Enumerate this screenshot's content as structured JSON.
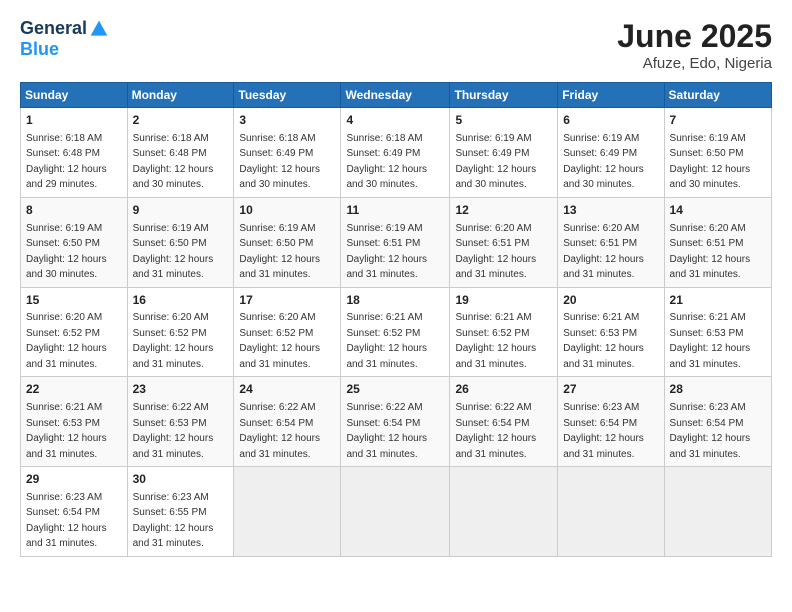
{
  "header": {
    "logo_general": "General",
    "logo_blue": "Blue",
    "month_title": "June 2025",
    "location": "Afuze, Edo, Nigeria"
  },
  "days_of_week": [
    "Sunday",
    "Monday",
    "Tuesday",
    "Wednesday",
    "Thursday",
    "Friday",
    "Saturday"
  ],
  "weeks": [
    [
      {
        "day": "1",
        "sunrise": "6:18 AM",
        "sunset": "6:48 PM",
        "daylight": "12 hours and 29 minutes."
      },
      {
        "day": "2",
        "sunrise": "6:18 AM",
        "sunset": "6:48 PM",
        "daylight": "12 hours and 30 minutes."
      },
      {
        "day": "3",
        "sunrise": "6:18 AM",
        "sunset": "6:49 PM",
        "daylight": "12 hours and 30 minutes."
      },
      {
        "day": "4",
        "sunrise": "6:18 AM",
        "sunset": "6:49 PM",
        "daylight": "12 hours and 30 minutes."
      },
      {
        "day": "5",
        "sunrise": "6:19 AM",
        "sunset": "6:49 PM",
        "daylight": "12 hours and 30 minutes."
      },
      {
        "day": "6",
        "sunrise": "6:19 AM",
        "sunset": "6:49 PM",
        "daylight": "12 hours and 30 minutes."
      },
      {
        "day": "7",
        "sunrise": "6:19 AM",
        "sunset": "6:50 PM",
        "daylight": "12 hours and 30 minutes."
      }
    ],
    [
      {
        "day": "8",
        "sunrise": "6:19 AM",
        "sunset": "6:50 PM",
        "daylight": "12 hours and 30 minutes."
      },
      {
        "day": "9",
        "sunrise": "6:19 AM",
        "sunset": "6:50 PM",
        "daylight": "12 hours and 31 minutes."
      },
      {
        "day": "10",
        "sunrise": "6:19 AM",
        "sunset": "6:50 PM",
        "daylight": "12 hours and 31 minutes."
      },
      {
        "day": "11",
        "sunrise": "6:19 AM",
        "sunset": "6:51 PM",
        "daylight": "12 hours and 31 minutes."
      },
      {
        "day": "12",
        "sunrise": "6:20 AM",
        "sunset": "6:51 PM",
        "daylight": "12 hours and 31 minutes."
      },
      {
        "day": "13",
        "sunrise": "6:20 AM",
        "sunset": "6:51 PM",
        "daylight": "12 hours and 31 minutes."
      },
      {
        "day": "14",
        "sunrise": "6:20 AM",
        "sunset": "6:51 PM",
        "daylight": "12 hours and 31 minutes."
      }
    ],
    [
      {
        "day": "15",
        "sunrise": "6:20 AM",
        "sunset": "6:52 PM",
        "daylight": "12 hours and 31 minutes."
      },
      {
        "day": "16",
        "sunrise": "6:20 AM",
        "sunset": "6:52 PM",
        "daylight": "12 hours and 31 minutes."
      },
      {
        "day": "17",
        "sunrise": "6:20 AM",
        "sunset": "6:52 PM",
        "daylight": "12 hours and 31 minutes."
      },
      {
        "day": "18",
        "sunrise": "6:21 AM",
        "sunset": "6:52 PM",
        "daylight": "12 hours and 31 minutes."
      },
      {
        "day": "19",
        "sunrise": "6:21 AM",
        "sunset": "6:52 PM",
        "daylight": "12 hours and 31 minutes."
      },
      {
        "day": "20",
        "sunrise": "6:21 AM",
        "sunset": "6:53 PM",
        "daylight": "12 hours and 31 minutes."
      },
      {
        "day": "21",
        "sunrise": "6:21 AM",
        "sunset": "6:53 PM",
        "daylight": "12 hours and 31 minutes."
      }
    ],
    [
      {
        "day": "22",
        "sunrise": "6:21 AM",
        "sunset": "6:53 PM",
        "daylight": "12 hours and 31 minutes."
      },
      {
        "day": "23",
        "sunrise": "6:22 AM",
        "sunset": "6:53 PM",
        "daylight": "12 hours and 31 minutes."
      },
      {
        "day": "24",
        "sunrise": "6:22 AM",
        "sunset": "6:54 PM",
        "daylight": "12 hours and 31 minutes."
      },
      {
        "day": "25",
        "sunrise": "6:22 AM",
        "sunset": "6:54 PM",
        "daylight": "12 hours and 31 minutes."
      },
      {
        "day": "26",
        "sunrise": "6:22 AM",
        "sunset": "6:54 PM",
        "daylight": "12 hours and 31 minutes."
      },
      {
        "day": "27",
        "sunrise": "6:23 AM",
        "sunset": "6:54 PM",
        "daylight": "12 hours and 31 minutes."
      },
      {
        "day": "28",
        "sunrise": "6:23 AM",
        "sunset": "6:54 PM",
        "daylight": "12 hours and 31 minutes."
      }
    ],
    [
      {
        "day": "29",
        "sunrise": "6:23 AM",
        "sunset": "6:54 PM",
        "daylight": "12 hours and 31 minutes."
      },
      {
        "day": "30",
        "sunrise": "6:23 AM",
        "sunset": "6:55 PM",
        "daylight": "12 hours and 31 minutes."
      },
      null,
      null,
      null,
      null,
      null
    ]
  ]
}
